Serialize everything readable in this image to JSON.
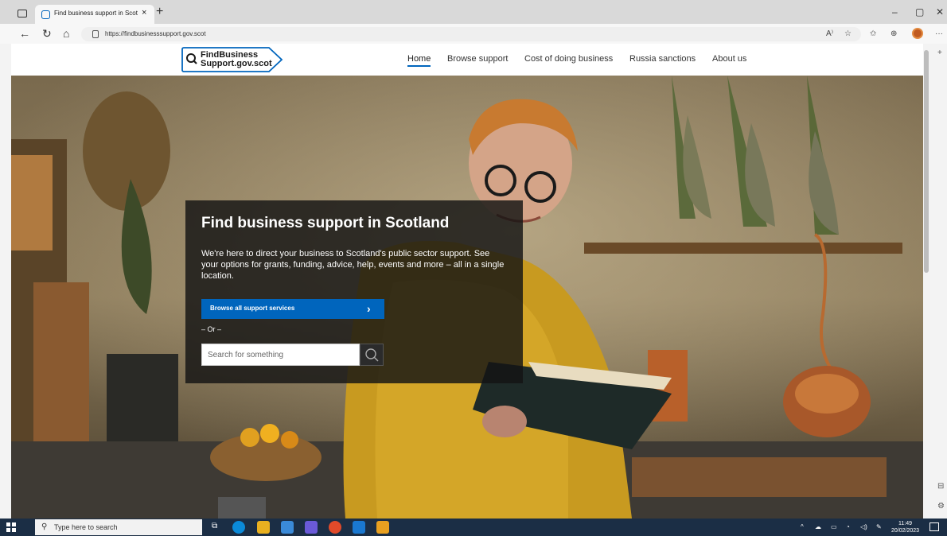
{
  "browser": {
    "tab_title": "Find business support in Scotlan",
    "tab_close": "×",
    "new_tab": "+",
    "url": "https://findbusinesssupport.gov.scot",
    "window_controls": {
      "minimize": "–",
      "restore": "▢",
      "close": "✕"
    },
    "nav": {
      "back": "←",
      "refresh": "↻",
      "home": "⌂"
    },
    "toolbar_icons": [
      "read-aloud-icon",
      "favorite-add-icon",
      "favorites-icon",
      "collections-icon",
      "profile-icon",
      "more-icon"
    ],
    "more": "···",
    "sidebar_add": "+"
  },
  "site": {
    "logo_line1": "FindBusiness",
    "logo_line2": "Support.gov.scot",
    "nav": [
      {
        "label": "Home",
        "active": true
      },
      {
        "label": "Browse support",
        "active": false
      },
      {
        "label": "Cost of doing business",
        "active": false
      },
      {
        "label": "Russia sanctions",
        "active": false
      },
      {
        "label": "About us",
        "active": false
      }
    ]
  },
  "hero": {
    "title": "Find business support in Scotland",
    "description": "We're here to direct your business to Scotland's public sector support. See your options for grants, funding, advice, help, events and more – all in a single location.",
    "browse_button": "Browse all support services",
    "browse_chevron": "›",
    "or_text": "– Or –",
    "search_placeholder": "Search for something"
  },
  "taskbar": {
    "search_placeholder": "Type here to search",
    "time": "11:49",
    "date": "20/02/2023",
    "apps": [
      "task-view-icon",
      "edge-icon",
      "file-explorer-icon",
      "store-icon",
      "teams-icon",
      "office-icon",
      "outlook-icon",
      "app-icon"
    ]
  },
  "colors": {
    "accent": "#0065bd",
    "panel_bg": "#141414",
    "taskbar_bg": "#1b2e45"
  }
}
